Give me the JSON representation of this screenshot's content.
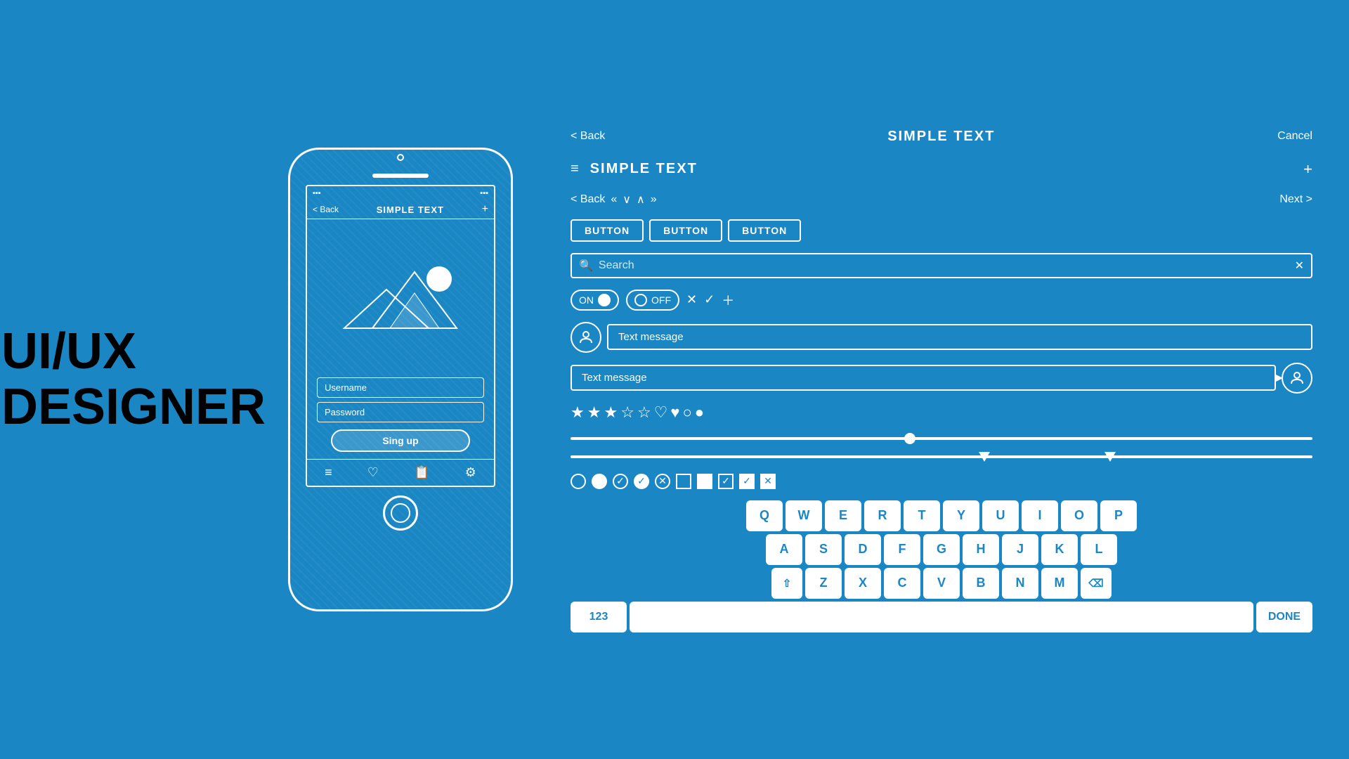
{
  "hero": {
    "title_line1": "UI/UX",
    "title_line2": "DESIGNER"
  },
  "phone": {
    "status_signal": "▪▪▪",
    "status_battery": "▪▪▪",
    "nav_back": "< Back",
    "nav_title": "SIMPLE TEXT",
    "nav_plus": "+",
    "username_placeholder": "Username",
    "password_placeholder": "Password",
    "signup_button": "Sing up",
    "bottom_nav": [
      "≡",
      "♡",
      "📋",
      "⚙"
    ]
  },
  "ui_kit": {
    "nav1": {
      "back": "< Back",
      "title": "SIMPLE TEXT",
      "cancel": "Cancel"
    },
    "nav2": {
      "menu": "≡",
      "title": "SIMPLE TEXT",
      "plus": "+"
    },
    "nav3": {
      "back": "< Back",
      "prev_prev": "«",
      "down": "∨",
      "up": "∧",
      "next_next": "»",
      "next": "Next >"
    },
    "buttons": [
      "BUTTON",
      "BUTTON",
      "BUTTON"
    ],
    "search": {
      "placeholder": "Search",
      "close": "✕"
    },
    "toggle_on": "ON",
    "toggle_off": "OFF",
    "chat": {
      "message1": "Text message",
      "message2": "Text message"
    },
    "keyboard": {
      "row1": [
        "Q",
        "W",
        "E",
        "R",
        "T",
        "Y",
        "U",
        "I",
        "O",
        "P"
      ],
      "row2": [
        "A",
        "S",
        "D",
        "F",
        "G",
        "H",
        "J",
        "K",
        "L"
      ],
      "row3_prefix": "⇧",
      "row3": [
        "Z",
        "X",
        "C",
        "V",
        "B",
        "N",
        "M"
      ],
      "row3_suffix": "⌫",
      "num_label": "123",
      "done_label": "DONE"
    }
  }
}
